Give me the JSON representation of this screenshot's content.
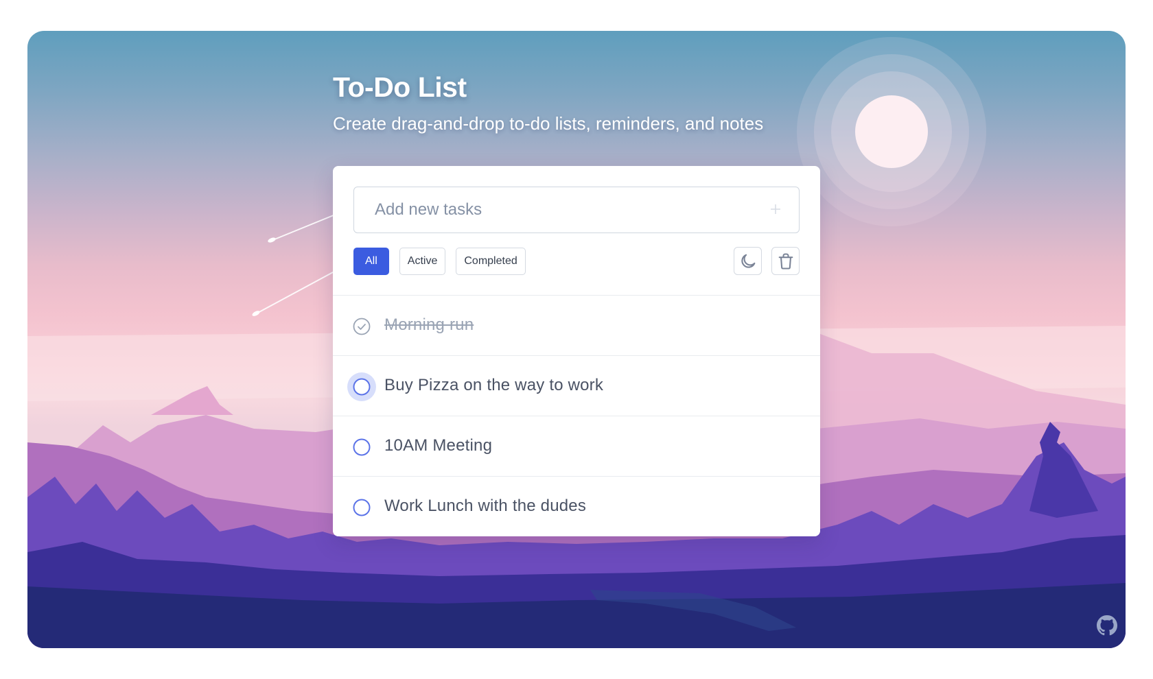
{
  "header": {
    "title": "To-Do List",
    "subtitle": "Create drag-and-drop to-do lists, reminders, and notes"
  },
  "input": {
    "placeholder": "Add new tasks",
    "value": "",
    "add_icon": "plus-icon"
  },
  "filters": [
    {
      "label": "All",
      "active": true
    },
    {
      "label": "Active",
      "active": false
    },
    {
      "label": "Completed",
      "active": false
    }
  ],
  "tools": {
    "theme_icon": "moon-icon",
    "clear_icon": "trash-icon"
  },
  "tasks": [
    {
      "text": "Morning run",
      "completed": true
    },
    {
      "text": "Buy Pizza on the way to work",
      "completed": false,
      "focused": true
    },
    {
      "text": "10AM Meeting",
      "completed": false
    },
    {
      "text": "Work Lunch with the dudes",
      "completed": false
    }
  ],
  "footer": {
    "github_icon": "github-icon"
  },
  "colors": {
    "accent": "#3b5ce0",
    "check_ring": "#5b73e8",
    "done_check": "#9aa4b4"
  }
}
